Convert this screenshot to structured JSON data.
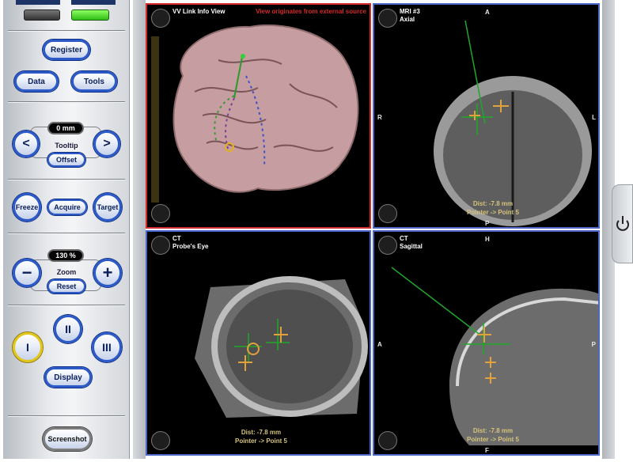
{
  "left_panel": {
    "register": "Register",
    "data": "Data",
    "tools": "Tools",
    "tooltip_value": "0 mm",
    "tooltip_label": "Tooltip",
    "offset": "Offset",
    "prev_icon": "<",
    "next_icon": ">",
    "freeze": "Freeze",
    "acquire": "Acquire",
    "target": "Target",
    "zoom_value": "130 %",
    "zoom_label": "Zoom",
    "reset": "Reset",
    "minus_icon": "−",
    "plus_icon": "+",
    "layout_1": "I",
    "layout_2": "II",
    "layout_3": "III",
    "display": "Display",
    "screenshot": "Screenshot"
  },
  "views": {
    "top_left": {
      "title": "VV Link Info View",
      "warning": "View originates from external source"
    },
    "top_right": {
      "modality": "MRI #3",
      "plane": "Axial",
      "dist": "Dist: -7.8 mm",
      "pointer": "Pointer -> Point 5",
      "orient_top": "A",
      "orient_left": "R",
      "orient_right": "L",
      "orient_bottom": "P"
    },
    "bottom_left": {
      "modality": "CT",
      "plane": "Probe's Eye",
      "dist": "Dist: -7.8 mm",
      "pointer": "Pointer -> Point 5"
    },
    "bottom_right": {
      "modality": "CT",
      "plane": "Sagittal",
      "dist": "Dist: -7.8 mm",
      "pointer": "Pointer -> Point 5",
      "orient_top": "H",
      "orient_left": "A",
      "orient_right": "P",
      "orient_bottom": "F"
    }
  },
  "colors": {
    "active_border": "#d42a2a",
    "view_border": "#4b67c8",
    "marker": "#e2a13a",
    "guide": "#1ea82a"
  }
}
